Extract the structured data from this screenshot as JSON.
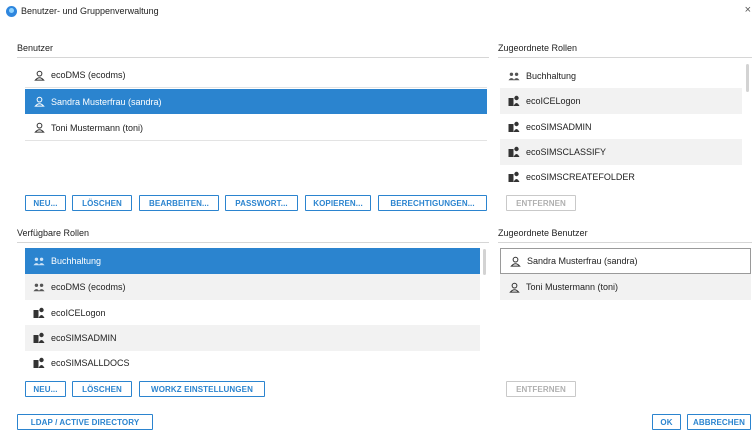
{
  "window": {
    "title": "Benutzer- und Gruppenverwaltung",
    "close_glyph": "×"
  },
  "users": {
    "label": "Benutzer",
    "items": [
      {
        "label": "ecoDMS (ecodms)",
        "icon": "user-icon"
      },
      {
        "label": "Sandra Musterfrau (sandra)",
        "icon": "user-icon",
        "selected": true
      },
      {
        "label": "Toni Mustermann (toni)",
        "icon": "user-icon"
      }
    ],
    "buttons": {
      "new": "NEU...",
      "delete": "LÖSCHEN",
      "edit": "BEARBEITEN...",
      "password": "PASSWORT...",
      "copy": "KOPIEREN...",
      "permissions": "BERECHTIGUNGEN..."
    }
  },
  "assigned_roles": {
    "label": "Zugeordnete Rollen",
    "items": [
      {
        "label": "Buchhaltung",
        "icon": "group-icon"
      },
      {
        "label": "ecoICELogon",
        "icon": "role-icon"
      },
      {
        "label": "ecoSIMSADMIN",
        "icon": "role-icon"
      },
      {
        "label": "ecoSIMSCLASSIFY",
        "icon": "role-icon"
      },
      {
        "label": "ecoSIMSCREATEFOLDER",
        "icon": "role-icon"
      }
    ],
    "remove_button": "ENTFERNEN"
  },
  "available_roles": {
    "label": "Verfügbare Rollen",
    "items": [
      {
        "label": "Buchhaltung",
        "icon": "group-icon",
        "selected": true
      },
      {
        "label": "ecoDMS (ecodms)",
        "icon": "group-icon"
      },
      {
        "label": "ecoICELogon",
        "icon": "role-icon"
      },
      {
        "label": "ecoSIMSADMIN",
        "icon": "role-icon"
      },
      {
        "label": "ecoSIMSALLDOCS",
        "icon": "role-icon"
      }
    ],
    "buttons": {
      "new": "NEU...",
      "delete": "LÖSCHEN",
      "workz": "WORKZ EINSTELLUNGEN"
    }
  },
  "assigned_users": {
    "label": "Zugeordnete Benutzer",
    "items": [
      {
        "label": "Sandra Musterfrau (sandra)",
        "icon": "user-icon"
      },
      {
        "label": "Toni Mustermann (toni)",
        "icon": "user-icon"
      }
    ],
    "remove_button": "ENTFERNEN"
  },
  "footer": {
    "ldap_button": "LDAP / ACTIVE DIRECTORY",
    "ok_button": "OK",
    "cancel_button": "ABBRECHEN"
  },
  "colors": {
    "accent": "#2b84cf",
    "selected_row": "#2b84cf",
    "alt_row": "#f2f2f2",
    "disabled": "#b0b0b0"
  }
}
